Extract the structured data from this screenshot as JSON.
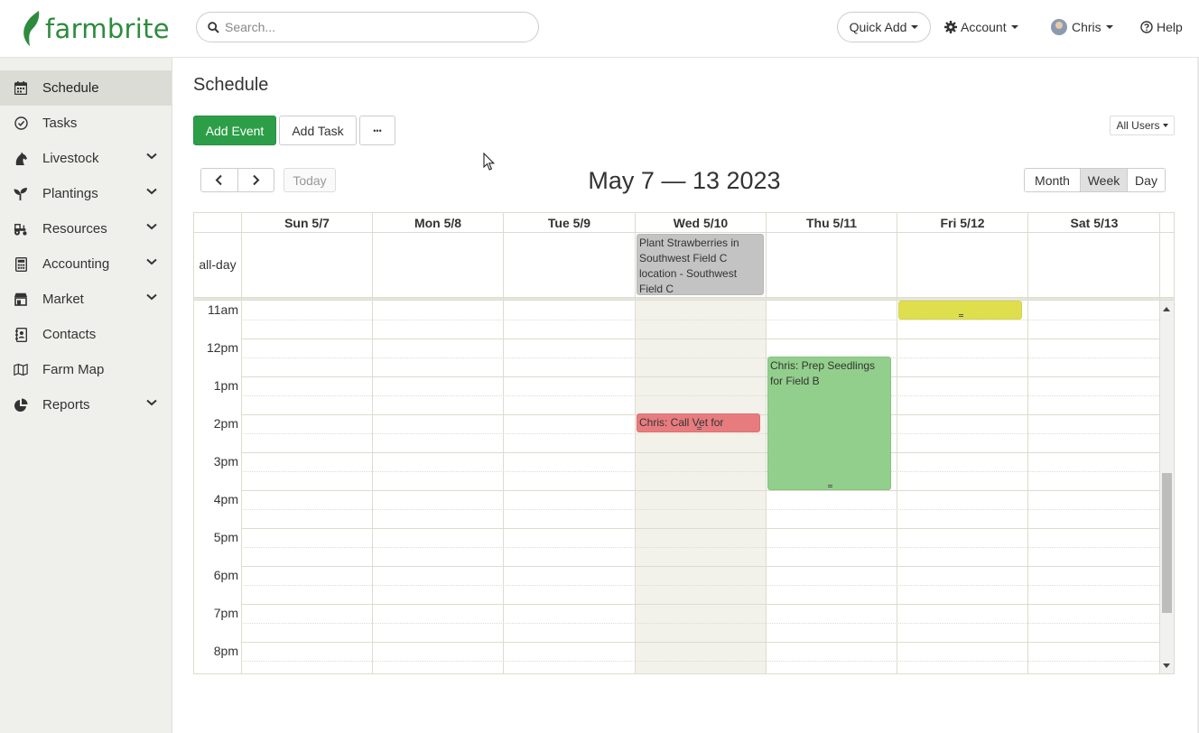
{
  "brand": {
    "name": "farmbrite",
    "color": "#2e8b3d"
  },
  "header": {
    "search_placeholder": "Search...",
    "quick_add": "Quick Add",
    "account": "Account",
    "user": "Chris",
    "help": "Help"
  },
  "sidebar": {
    "items": [
      {
        "label": "Schedule",
        "icon": "calendar-icon",
        "has_submenu": false,
        "active": true
      },
      {
        "label": "Tasks",
        "icon": "check-circle-icon",
        "has_submenu": false
      },
      {
        "label": "Livestock",
        "icon": "horse-icon",
        "has_submenu": true
      },
      {
        "label": "Plantings",
        "icon": "seedling-icon",
        "has_submenu": true
      },
      {
        "label": "Resources",
        "icon": "tractor-icon",
        "has_submenu": true
      },
      {
        "label": "Accounting",
        "icon": "calculator-icon",
        "has_submenu": true
      },
      {
        "label": "Market",
        "icon": "store-icon",
        "has_submenu": true
      },
      {
        "label": "Contacts",
        "icon": "address-book-icon",
        "has_submenu": false
      },
      {
        "label": "Farm Map",
        "icon": "map-icon",
        "has_submenu": false
      },
      {
        "label": "Reports",
        "icon": "pie-chart-icon",
        "has_submenu": true
      }
    ]
  },
  "main": {
    "title": "Schedule",
    "add_event": "Add Event",
    "add_task": "Add Task",
    "more": "•••",
    "all_users": "All Users",
    "today": "Today",
    "range_title": "May 7 — 13 2023",
    "views": {
      "month": "Month",
      "week": "Week",
      "day": "Day",
      "selected": "Week"
    }
  },
  "calendar": {
    "days": [
      "Sun 5/7",
      "Mon 5/8",
      "Tue 5/9",
      "Wed 5/10",
      "Thu 5/11",
      "Fri 5/12",
      "Sat 5/13"
    ],
    "today_index": 3,
    "allday_label": "all-day",
    "times": [
      "11am",
      "12pm",
      "1pm",
      "2pm",
      "3pm",
      "4pm",
      "5pm",
      "6pm",
      "7pm",
      "8pm"
    ],
    "events": {
      "allday": {
        "title": "Plant Strawberries in Southwest Field C location - Southwest Field C",
        "day": "Wed 5/10",
        "color": "#c3c3c3"
      },
      "yellow": {
        "title": "",
        "day": "Fri 5/12",
        "color": "#dfdf4d"
      },
      "red": {
        "title": "Chris: Call Vet for",
        "day": "Wed 5/10",
        "color": "#e77c7f"
      },
      "green": {
        "title": "Chris: Prep Seedlings for Field B",
        "day": "Thu 5/11",
        "color": "#93cf8c"
      }
    }
  },
  "colors": {
    "primary_button": "#2d9e48",
    "sidebar_bg": "#efefeb",
    "today_column": "#f2f2ea"
  }
}
